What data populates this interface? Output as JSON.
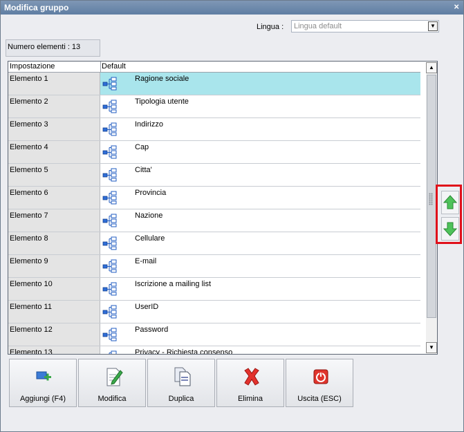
{
  "window": {
    "title": "Modifica gruppo",
    "close_label": "×"
  },
  "language": {
    "label": "Lingua :",
    "value": "Lingua default"
  },
  "count_text": "Numero elementi : 13",
  "grid": {
    "columns": [
      "Impostazione",
      "Default"
    ],
    "rows": [
      {
        "setting": "Elemento 1",
        "value": "Ragione sociale",
        "selected": true
      },
      {
        "setting": "Elemento 2",
        "value": "Tipologia utente"
      },
      {
        "setting": "Elemento 3",
        "value": "Indirizzo"
      },
      {
        "setting": "Elemento 4",
        "value": "Cap"
      },
      {
        "setting": "Elemento 5",
        "value": "Citta'"
      },
      {
        "setting": "Elemento 6",
        "value": "Provincia"
      },
      {
        "setting": "Elemento 7",
        "value": "Nazione"
      },
      {
        "setting": "Elemento 8",
        "value": "Cellulare"
      },
      {
        "setting": "Elemento 9",
        "value": "E-mail"
      },
      {
        "setting": "Elemento 10",
        "value": "Iscrizione a mailing list"
      },
      {
        "setting": "Elemento 11",
        "value": "UserID"
      },
      {
        "setting": "Elemento 12",
        "value": "Password"
      },
      {
        "setting": "Elemento 13",
        "value": "Privacy - Richiesta consenso"
      }
    ]
  },
  "toolbar": {
    "add_label": "Aggiungi (F4)",
    "edit_label": "Modifica",
    "duplicate_label": "Duplica",
    "delete_label": "Elimina",
    "exit_label": "Uscita (ESC)"
  },
  "icons": {
    "row_icon": "hierarchy-icon",
    "move_up": "arrow-up-icon",
    "move_down": "arrow-down-icon"
  },
  "colors": {
    "selected_row": "#a9e5ec",
    "highlight_border": "#e0101a",
    "title_bar": "#6f8bad"
  }
}
